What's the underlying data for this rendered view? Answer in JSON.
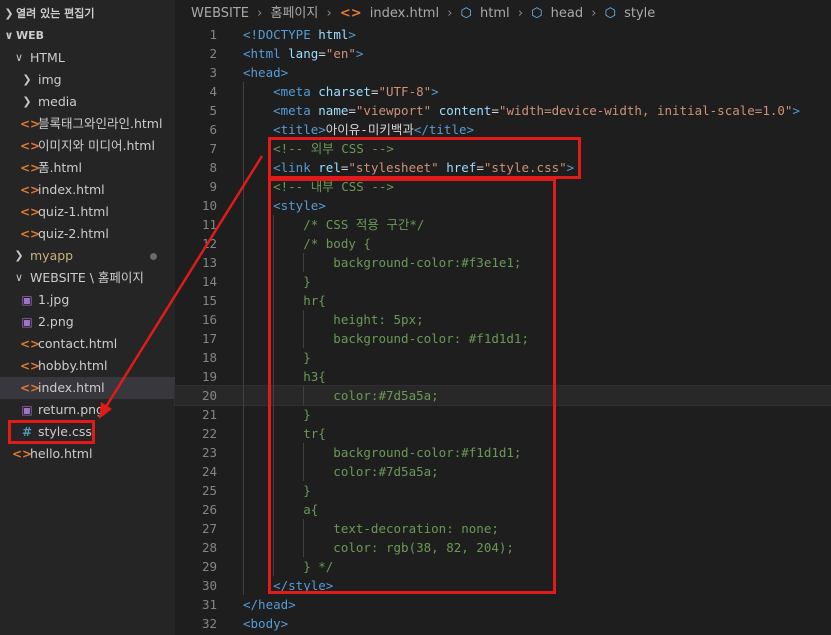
{
  "sidebar": {
    "open_editors": "열려 있는 편집기",
    "workspace": "WEB",
    "html_folder": "HTML",
    "img_folder": "img",
    "media_folder": "media",
    "html_files": [
      "블록태그와인라인.html",
      "이미지와 미디어.html",
      "폼.html",
      "index.html",
      "quiz-1.html",
      "quiz-2.html"
    ],
    "myapp_folder": "myapp",
    "website_folder": "WEBSITE \\ 홈페이지",
    "website_files": [
      {
        "name": "1.jpg",
        "icon": "image-icon"
      },
      {
        "name": "2.png",
        "icon": "image-icon"
      },
      {
        "name": "contact.html",
        "icon": "html-icon"
      },
      {
        "name": "hobby.html",
        "icon": "html-icon"
      },
      {
        "name": "index.html",
        "icon": "html-icon"
      },
      {
        "name": "return.png",
        "icon": "image-icon"
      },
      {
        "name": "style.css",
        "icon": "css-icon"
      }
    ],
    "root_file": "hello.html"
  },
  "breadcrumb": {
    "folder1": "WEBSITE",
    "folder2": "홈페이지",
    "file": "index.html",
    "sym1": "html",
    "sym2": "head",
    "sym3": "style"
  },
  "code": {
    "line_numbers": [
      "1",
      "2",
      "3",
      "4",
      "5",
      "6",
      "7",
      "8",
      "9",
      "10",
      "11",
      "12",
      "13",
      "14",
      "15",
      "16",
      "17",
      "18",
      "19",
      "20",
      "21",
      "22",
      "23",
      "24",
      "25",
      "26",
      "27",
      "28",
      "29",
      "30",
      "31",
      "32"
    ],
    "lines": [
      [
        [
          "t-tag",
          "<!DOCTYPE "
        ],
        [
          "t-attr",
          "html"
        ],
        [
          "t-tag",
          ">"
        ]
      ],
      [
        [
          "t-tag",
          "<html "
        ],
        [
          "t-attr",
          "lang"
        ],
        [
          "t-text",
          "="
        ],
        [
          "t-val",
          "\"en\""
        ],
        [
          "t-tag",
          ">"
        ]
      ],
      [
        [
          "t-tag",
          "<head>"
        ]
      ],
      [
        [
          "t-tag",
          "    <meta "
        ],
        [
          "t-attr",
          "charset"
        ],
        [
          "t-text",
          "="
        ],
        [
          "t-val",
          "\"UTF-8\""
        ],
        [
          "t-tag",
          ">"
        ]
      ],
      [
        [
          "t-tag",
          "    <meta "
        ],
        [
          "t-attr",
          "name"
        ],
        [
          "t-text",
          "="
        ],
        [
          "t-val",
          "\"viewport\""
        ],
        [
          "t-text",
          " "
        ],
        [
          "t-attr",
          "content"
        ],
        [
          "t-text",
          "="
        ],
        [
          "t-val",
          "\"width=device-width, initial-scale=1.0\""
        ],
        [
          "t-tag",
          ">"
        ]
      ],
      [
        [
          "t-tag",
          "    <title>"
        ],
        [
          "t-text",
          "아이유-미키백과"
        ],
        [
          "t-tag",
          "</title>"
        ]
      ],
      [
        [
          "t-cmt",
          "    <!-- 외부 CSS -->"
        ]
      ],
      [
        [
          "t-tag",
          "    <link "
        ],
        [
          "t-attr",
          "rel"
        ],
        [
          "t-text",
          "="
        ],
        [
          "t-val",
          "\"stylesheet\""
        ],
        [
          "t-text",
          " "
        ],
        [
          "t-attr",
          "href"
        ],
        [
          "t-text",
          "="
        ],
        [
          "t-val",
          "\"style.css\""
        ],
        [
          "t-tag",
          ">"
        ]
      ],
      [
        [
          "t-cmt",
          "    <!-- 내부 CSS -->"
        ]
      ],
      [
        [
          "t-tag",
          "    <style>"
        ]
      ],
      [
        [
          "t-cmt",
          "        /* CSS 적용 구간*/"
        ]
      ],
      [
        [
          "t-cmt",
          "        /* body {"
        ]
      ],
      [
        [
          "t-cmt",
          "            background-color:#f3e1e1;"
        ]
      ],
      [
        [
          "t-cmt",
          "        }"
        ]
      ],
      [
        [
          "t-cmt",
          "        hr{"
        ]
      ],
      [
        [
          "t-cmt",
          "            height: 5px;"
        ]
      ],
      [
        [
          "t-cmt",
          "            background-color: #f1d1d1;"
        ]
      ],
      [
        [
          "t-cmt",
          "        }"
        ]
      ],
      [
        [
          "t-cmt",
          "        h3{"
        ]
      ],
      [
        [
          "t-cmt",
          "            color:#7d5a5a;"
        ]
      ],
      [
        [
          "t-cmt",
          "        }"
        ]
      ],
      [
        [
          "t-cmt",
          "        tr{"
        ]
      ],
      [
        [
          "t-cmt",
          "            background-color:#f1d1d1;"
        ]
      ],
      [
        [
          "t-cmt",
          "            color:#7d5a5a;"
        ]
      ],
      [
        [
          "t-cmt",
          "        }"
        ]
      ],
      [
        [
          "t-cmt",
          "        a{"
        ]
      ],
      [
        [
          "t-cmt",
          "            text-decoration: none;"
        ]
      ],
      [
        [
          "t-cmt",
          "            color: rgb(38, 82, 204);"
        ]
      ],
      [
        [
          "t-cmt",
          "        } */"
        ]
      ],
      [
        [
          "t-tag",
          "    </style>"
        ]
      ],
      [
        [
          "t-tag",
          "</head>"
        ]
      ],
      [
        [
          "t-tag",
          "<body>"
        ]
      ]
    ]
  },
  "colors": {
    "annotation_red": "#e11a1a",
    "comment_green": "#6a9955",
    "tag_blue": "#569cd6"
  }
}
